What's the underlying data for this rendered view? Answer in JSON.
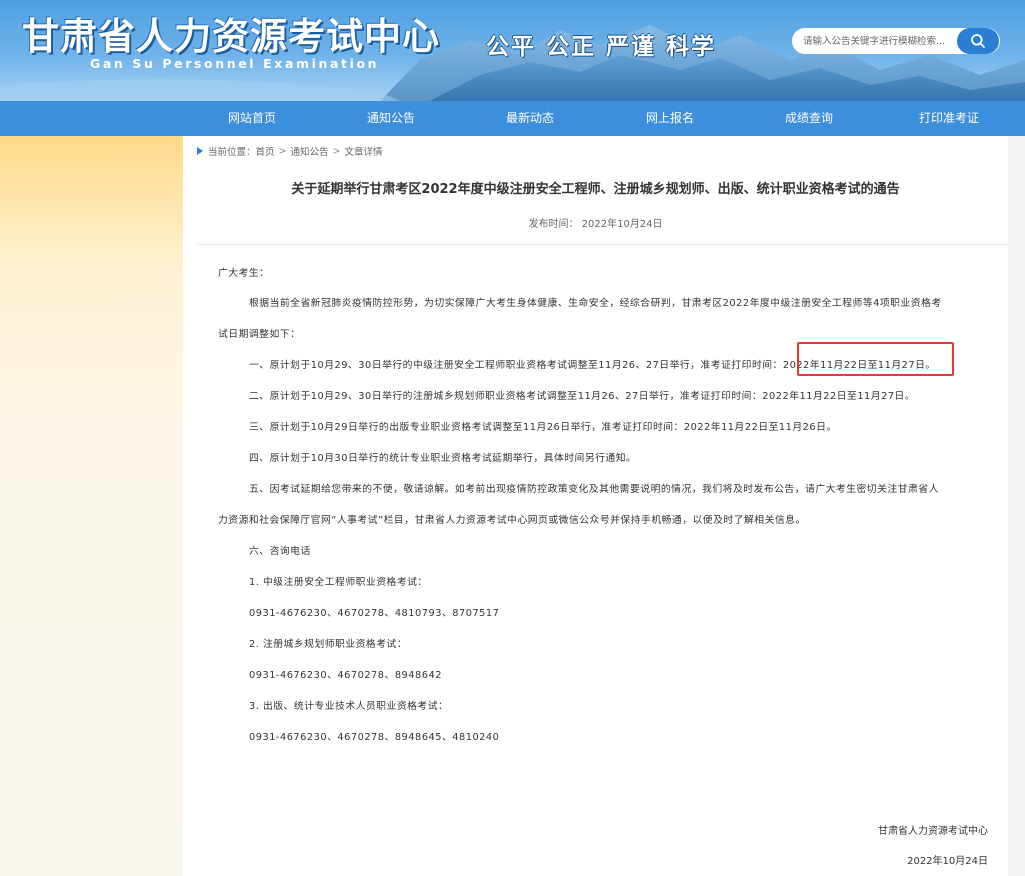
{
  "header": {
    "site_title": "甘肃省人力资源考试中心",
    "site_subtitle": "Gan Su Personnel Examination",
    "slogan": "公平 公正 严谨 科学",
    "search_placeholder": "请输入公告关键字进行模糊检索...",
    "search_icon": "search-icon"
  },
  "nav": {
    "items": [
      "网站首页",
      "通知公告",
      "最新动态",
      "网上报名",
      "成绩查询",
      "打印准考证"
    ]
  },
  "breadcrumb": {
    "label": "当前位置：",
    "items": [
      "首页",
      "通知公告",
      "文章详情"
    ],
    "separator": ">"
  },
  "article": {
    "title": "关于延期举行甘肃考区2022年度中级注册安全工程师、注册城乡规划师、出版、统计职业资格考试的通告",
    "publish_time": "发布时间： 2022年10月24日",
    "greeting": "广大考生：",
    "intro_line1": "根据当前全省新冠肺炎疫情防控形势，为切实保障广大考生身体健康、生命安全，经综合研判，甘肃考区2022年度中级注册安全工程师等4项职业资格考",
    "intro_line2": "试日期调整如下：",
    "item1": "一、原计划于10月29、30日举行的中级注册安全工程师职业资格考试调整至11月26、27日举行，准考证打印时间：2022年11月22日至11月27日。",
    "item2": "二、原计划于10月29、30日举行的注册城乡规划师职业资格考试调整至11月26、27日举行，准考证打印时间：2022年11月22日至11月27日。",
    "item3": "三、原计划于10月29日举行的出版专业职业资格考试调整至11月26日举行，准考证打印时间：2022年11月22日至11月26日。",
    "item4": "四、原计划于10月30日举行的统计专业职业资格考试延期举行，具体时间另行通知。",
    "item5_line1": "五、因考试延期给您带来的不便，敬请谅解。如考前出现疫情防控政策变化及其他需要说明的情况，我们将及时发布公告，请广大考生密切关注甘肃省人",
    "item5_line2": "力资源和社会保障厅官网“人事考试”栏目，甘肃省人力资源考试中心网页或微信公众号并保持手机畅通，以便及时了解相关信息。",
    "item6": "六、咨询电话",
    "contact1_label": "1. 中级注册安全工程师职业资格考试：",
    "contact1_phone": "0931-4676230、4670278、4810793、8707517",
    "contact2_label": "2. 注册城乡规划师职业资格考试：",
    "contact2_phone": "0931-4676230、4670278、8948642",
    "contact3_label": "3. 出版、统计专业技术人员职业资格考试：",
    "contact3_phone": "0931-4676230、4670278、8948645、4810240",
    "signature": "甘肃省人力资源考试中心",
    "sign_date": "2022年10月24日"
  },
  "colors": {
    "nav_bg": "#3b8fdc",
    "highlight_border": "#e53935",
    "accent": "#2a7fd4"
  }
}
